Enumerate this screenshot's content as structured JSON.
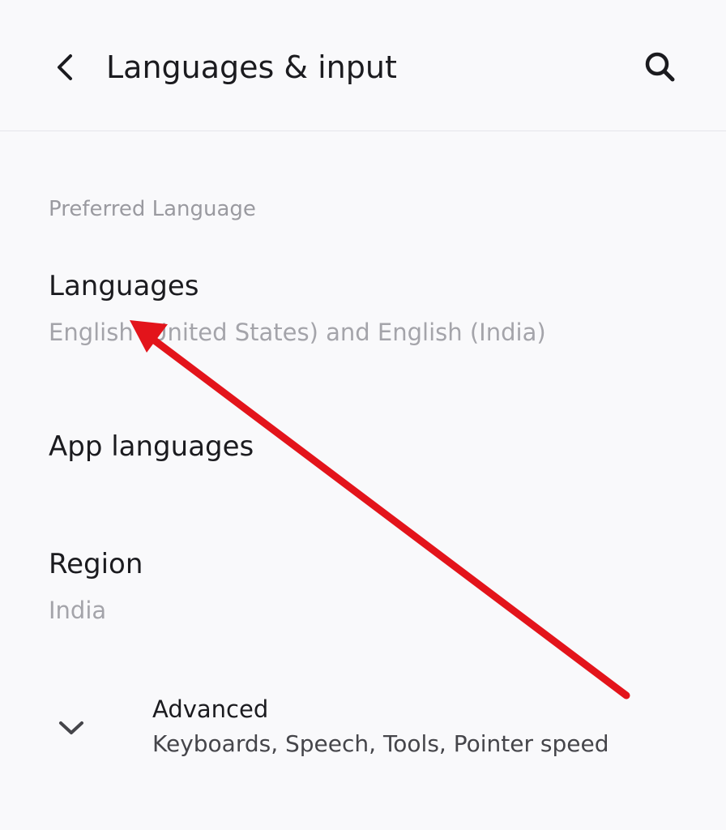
{
  "header": {
    "title": "Languages & input",
    "back_icon": "chevron-left-icon",
    "search_icon": "search-icon"
  },
  "sections": {
    "preferred_language": {
      "header": "Preferred Language"
    }
  },
  "items": {
    "languages": {
      "title": "Languages",
      "summary": "English (United States) and English (India)"
    },
    "app_languages": {
      "title": "App languages"
    },
    "region": {
      "title": "Region",
      "summary": "India"
    },
    "advanced": {
      "title": "Advanced",
      "summary": "Keyboards, Speech, Tools, Pointer speed",
      "icon": "chevron-down-icon"
    }
  },
  "annotation": {
    "type": "arrow",
    "color": "#e3141b",
    "target": "Languages"
  },
  "colors": {
    "background": "#f9f9fb",
    "text_primary": "#1b1b1f",
    "text_secondary": "#a4a4aa",
    "divider": "#e6e6ea"
  }
}
